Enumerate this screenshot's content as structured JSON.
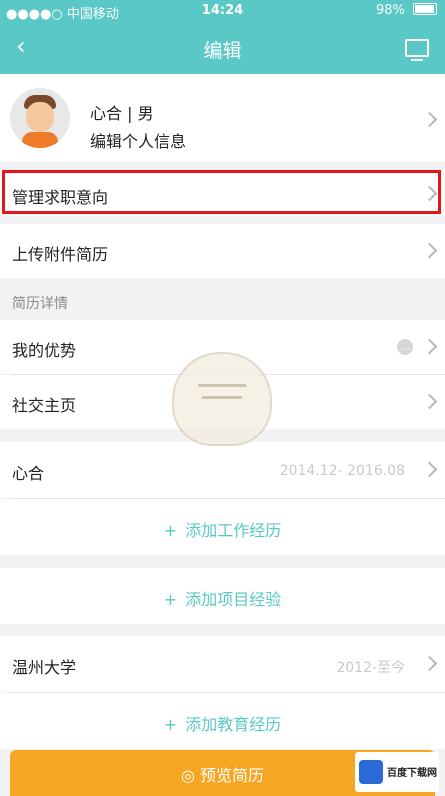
{
  "status_bar": {
    "carrier": "●●●●○ 中国移动",
    "time": "14:24",
    "battery": "98%"
  },
  "nav": {
    "title": "编辑"
  },
  "profile": {
    "name": "心合 | 男",
    "edit_label": "编辑个人信息"
  },
  "rows": {
    "intent": "管理求职意向",
    "upload": "上传附件简历"
  },
  "resume_details": {
    "header": "简历详情",
    "advantage": "我的优势",
    "social": "社交主页"
  },
  "work": {
    "company": "心合",
    "dates": "2014.12- 2016.08",
    "add_label": "添加工作经历"
  },
  "project": {
    "add_label": "添加项目经验"
  },
  "education": {
    "school": "温州大学",
    "dates": "2012-至今",
    "add_label": "添加教育经历"
  },
  "preview": {
    "label": "预览简历"
  },
  "watermark": {
    "text": "百度下载网"
  }
}
